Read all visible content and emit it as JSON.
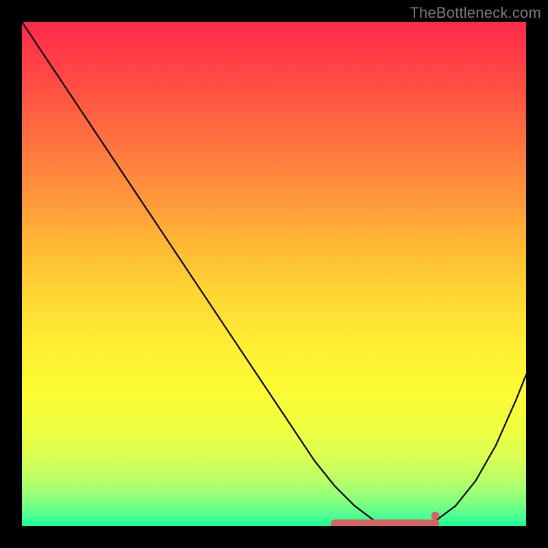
{
  "watermark": "TheBottleneck.com",
  "chart_data": {
    "type": "line",
    "title": "",
    "xlabel": "",
    "ylabel": "",
    "xlim": [
      0,
      100
    ],
    "ylim": [
      0,
      100
    ],
    "grid": false,
    "legend": false,
    "series": [
      {
        "name": "bottleneck-curve",
        "x": [
          0,
          6,
          12,
          18,
          24,
          30,
          36,
          42,
          48,
          54,
          58,
          62,
          66,
          70,
          74,
          78,
          82,
          86,
          90,
          94,
          98,
          100
        ],
        "y": [
          100,
          91,
          82,
          73,
          64,
          55,
          46,
          37,
          28,
          19,
          13,
          8,
          4,
          1,
          0,
          0,
          1,
          4,
          9,
          16,
          25,
          30
        ]
      }
    ],
    "optimum_band": {
      "x_start": 62,
      "x_end": 82,
      "y": 0
    },
    "optimum_marker": {
      "x": 82,
      "y": 1.5
    },
    "background": {
      "kind": "vertical-gradient",
      "meaning": "red=high bottleneck, green=low bottleneck",
      "stops": [
        {
          "pos": 0,
          "color": "#ff2a4d"
        },
        {
          "pos": 50,
          "color": "#ffd934"
        },
        {
          "pos": 100,
          "color": "#12ff92"
        }
      ]
    }
  }
}
